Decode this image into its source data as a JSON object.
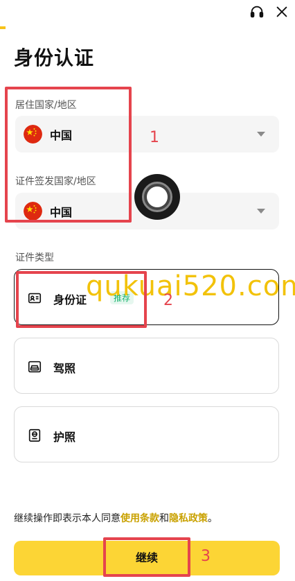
{
  "header": {
    "support_icon": "headset-icon",
    "close_icon": "close-icon"
  },
  "page": {
    "title": "身份认证"
  },
  "residence": {
    "label": "居住国家/地区",
    "value": "中国",
    "flag_icon": "china-flag-icon"
  },
  "issuing": {
    "label": "证件签发国家/地区",
    "value": "中国",
    "flag_icon": "china-flag-icon"
  },
  "document_type": {
    "label": "证件类型",
    "options": [
      {
        "label": "身份证",
        "icon": "id-card-icon",
        "badge": "推荐",
        "selected": true
      },
      {
        "label": "驾照",
        "icon": "car-icon",
        "badge": "",
        "selected": false
      },
      {
        "label": "护照",
        "icon": "passport-icon",
        "badge": "",
        "selected": false
      }
    ]
  },
  "consent": {
    "prefix": "继续操作即表示本人同意",
    "terms_link": "使用条款",
    "and": "和",
    "privacy_link": "隐私政策",
    "suffix": "。"
  },
  "actions": {
    "continue_label": "继续"
  },
  "annotations": {
    "n1": "1",
    "n2": "2",
    "n3": "3",
    "color": "#e5444d"
  },
  "watermark": {
    "text": "qukuai520.com"
  },
  "colors": {
    "accent": "#fcd535",
    "link": "#c9a100",
    "badge_text": "#14b36b"
  }
}
